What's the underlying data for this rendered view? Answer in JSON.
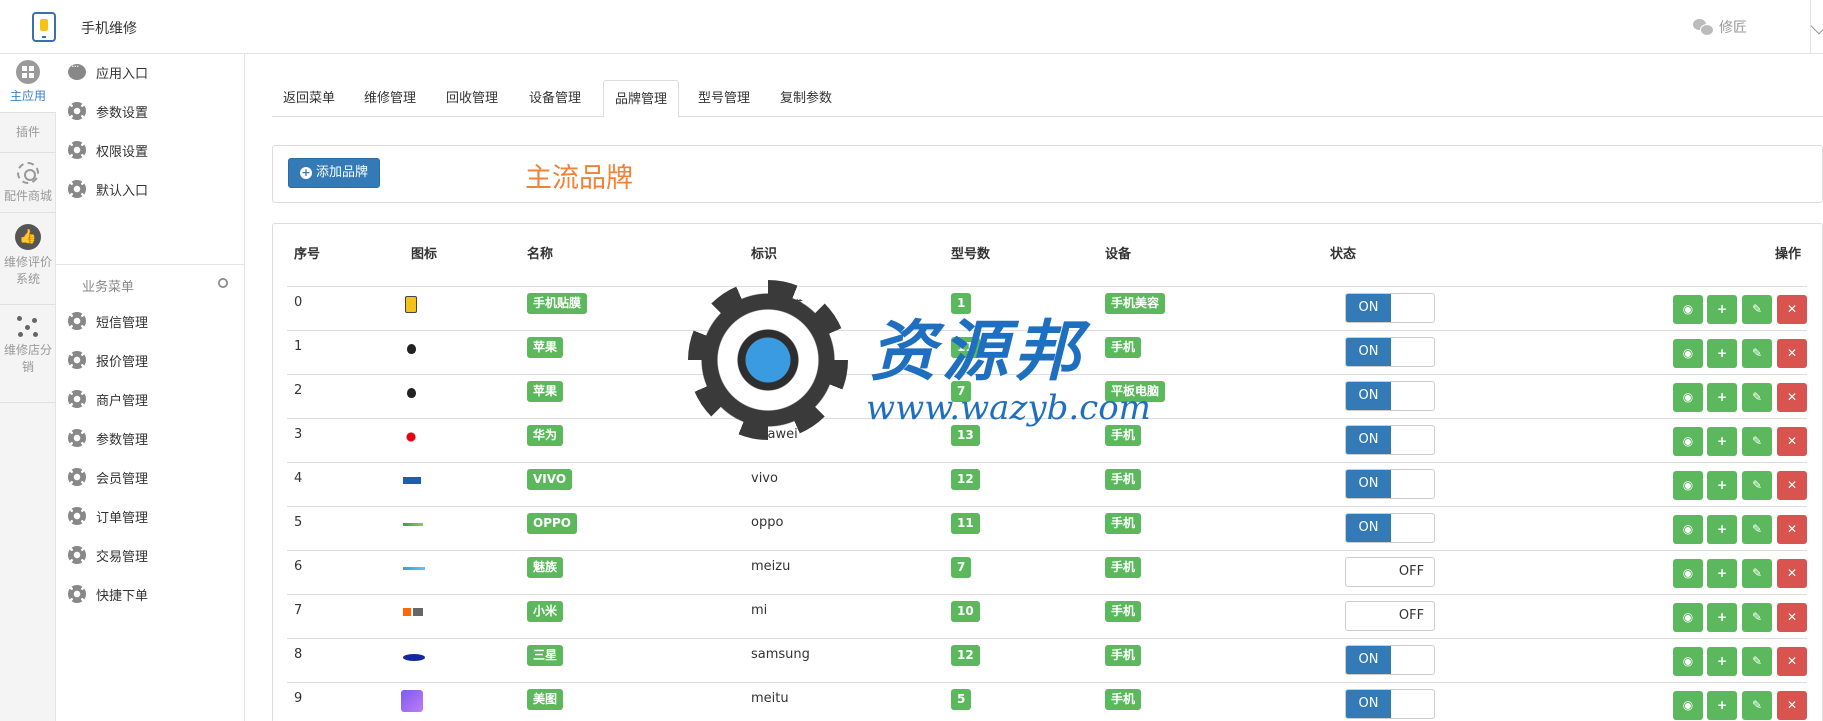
{
  "header": {
    "app_title": "手机维修",
    "user_name": "修匠"
  },
  "rail": {
    "items": [
      {
        "label": "主应用",
        "icon": "grid-icon"
      },
      {
        "label": "插件",
        "icon": ""
      },
      {
        "label": "配件商城",
        "icon": "cog-icon"
      },
      {
        "label": "维修评价系统",
        "icon": "thumbs-up-icon"
      },
      {
        "label": "维修店分销",
        "icon": "share-icon"
      }
    ]
  },
  "sidebar": {
    "top_items": [
      "应用入口",
      "参数设置",
      "权限设置",
      "默认入口"
    ],
    "group_title": "业务菜单",
    "group_items": [
      "短信管理",
      "报价管理",
      "商户管理",
      "参数管理",
      "会员管理",
      "订单管理",
      "交易管理",
      "快捷下单"
    ]
  },
  "tabs": [
    "返回菜单",
    "维修管理",
    "回收管理",
    "设备管理",
    "品牌管理",
    "型号管理",
    "复制参数"
  ],
  "active_tab": "品牌管理",
  "toolbar": {
    "add_label": "添加品牌",
    "section_title": "主流品牌"
  },
  "table": {
    "columns": [
      "序号",
      "图标",
      "名称",
      "标识",
      "型号数",
      "设备",
      "状态",
      "操作"
    ],
    "rows": [
      {
        "index": "0",
        "name": "手机贴膜",
        "code": "手机贴膜",
        "models": "1",
        "device": "手机美容",
        "status": "ON",
        "icon": "film-icon"
      },
      {
        "index": "1",
        "name": "苹果",
        "code": "iphone",
        "models": "11",
        "device": "手机",
        "status": "ON",
        "icon": "apple-icon"
      },
      {
        "index": "2",
        "name": "苹果",
        "code": "ipad",
        "models": "7",
        "device": "平板电脑",
        "status": "ON",
        "icon": "apple-icon"
      },
      {
        "index": "3",
        "name": "华为",
        "code": "huawei",
        "models": "13",
        "device": "手机",
        "status": "ON",
        "icon": "huawei-icon"
      },
      {
        "index": "4",
        "name": "VIVO",
        "code": "vivo",
        "models": "12",
        "device": "手机",
        "status": "ON",
        "icon": "vivo-icon"
      },
      {
        "index": "5",
        "name": "OPPO",
        "code": "oppo",
        "models": "11",
        "device": "手机",
        "status": "ON",
        "icon": "oppo-icon"
      },
      {
        "index": "6",
        "name": "魅族",
        "code": "meizu",
        "models": "7",
        "device": "手机",
        "status": "OFF",
        "icon": "meizu-icon"
      },
      {
        "index": "7",
        "name": "小米",
        "code": "mi",
        "models": "10",
        "device": "手机",
        "status": "OFF",
        "icon": "mi-icon"
      },
      {
        "index": "8",
        "name": "三星",
        "code": "samsung",
        "models": "12",
        "device": "手机",
        "status": "ON",
        "icon": "samsung-icon"
      },
      {
        "index": "9",
        "name": "美图",
        "code": "meitu",
        "models": "5",
        "device": "手机",
        "status": "ON",
        "icon": "meitu-icon"
      }
    ]
  },
  "watermark": {
    "text": "资源邦",
    "url": "www.wazyb.com"
  },
  "colors": {
    "primary": "#337ab7",
    "success": "#5cb85c",
    "danger": "#d9534f",
    "accent": "#f0823a"
  }
}
